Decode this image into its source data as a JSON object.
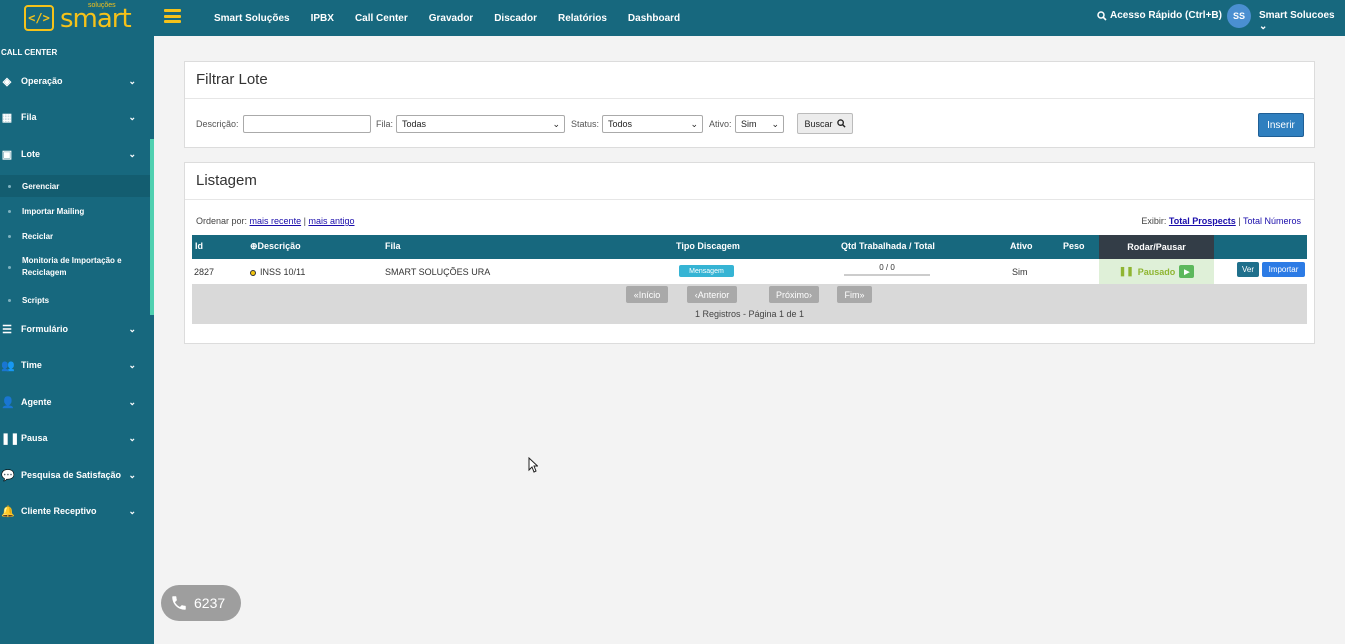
{
  "brand": {
    "small": "soluções",
    "name": "smart",
    "mark": "</>"
  },
  "topnav": [
    "Smart Soluções",
    "IPBX",
    "Call Center",
    "Gravador",
    "Discador",
    "Relatórios",
    "Dashboard"
  ],
  "quick_access": "Acesso Rápido (Ctrl+B)",
  "user": {
    "initials": "SS",
    "name": "Smart Solucoes"
  },
  "sidebar": {
    "heading": "CALL CENTER",
    "items": [
      {
        "label": "Operação",
        "icon": "cube-icon"
      },
      {
        "label": "Fila",
        "icon": "grid-icon"
      },
      {
        "label": "Lote",
        "icon": "box-icon"
      },
      {
        "label": "Formulário",
        "icon": "list-icon"
      },
      {
        "label": "Time",
        "icon": "users-icon"
      },
      {
        "label": "Agente",
        "icon": "user-icon"
      },
      {
        "label": "Pausa",
        "icon": "pause-icon"
      },
      {
        "label": "Pesquisa de Satisfação",
        "icon": "comment-icon"
      },
      {
        "label": "Cliente Receptivo",
        "icon": "bell-icon"
      }
    ],
    "lote_sub": [
      "Gerenciar",
      "Importar Mailing",
      "Reciclar",
      "Monitoria de Importação e Reciclagem",
      "Scripts"
    ]
  },
  "filter": {
    "title": "Filtrar Lote",
    "descricao_label": "Descrição:",
    "descricao_value": "",
    "fila_label": "Fila:",
    "fila_value": "Todas",
    "status_label": "Status:",
    "status_value": "Todos",
    "ativo_label": "Ativo:",
    "ativo_value": "Sim",
    "buscar": "Buscar",
    "inserir": "Inserir"
  },
  "listing": {
    "title": "Listagem",
    "order_label": "Ordenar por:",
    "order_recent": "mais recente",
    "order_sep": "|",
    "order_old": "mais antigo",
    "exibir_label": "Exibir:",
    "exibir_prospects": "Total Prospects",
    "exibir_sep": "|",
    "exibir_numeros": "Total Números",
    "columns": [
      "Id",
      "Descrição",
      "Fila",
      "Tipo Discagem",
      "Qtd Trabalhada / Total",
      "Ativo",
      "Peso",
      "Rodar/Pausar"
    ],
    "sort_icon_label": "⊕",
    "row": {
      "id": "2827",
      "descricao": "INSS 10/11",
      "fila": "SMART SOLUÇÕES URA",
      "tipo": "Mensagem",
      "qtd": "0 / 0",
      "qtd_progress": 0,
      "ativo": "Sim",
      "peso": "",
      "rodar": "Pausado",
      "ver": "Ver",
      "importar": "Importar"
    },
    "pager": {
      "inicio": "Início",
      "anterior": "Anterior",
      "proximo": "Próximo",
      "fim": "Fim",
      "info": "1 Registros - Página 1 de 1"
    }
  },
  "phone": {
    "number": "6237"
  },
  "colors": {
    "primary": "#17687e",
    "accent": "#f5c21a",
    "active_bar": "#4fd0b0"
  }
}
